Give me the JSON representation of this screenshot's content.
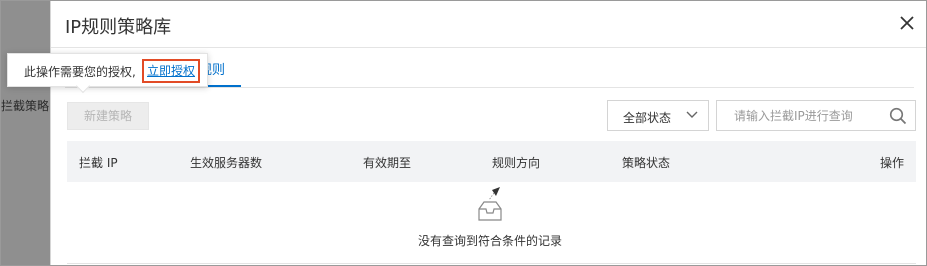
{
  "background": {
    "partial_text": "拦截策略"
  },
  "dialog": {
    "title": "IP规则策略库",
    "tab_active_label_visible": "规则"
  },
  "tooltip": {
    "text": "此操作需要您的授权,",
    "link_label": "立即授权"
  },
  "toolbar": {
    "new_button_label": "新建策略",
    "status_select_value": "全部状态",
    "search_placeholder": "请输入拦截IP进行查询"
  },
  "table": {
    "columns": [
      "拦截 IP",
      "生效服务器数",
      "有效期至",
      "规则方向",
      "策略状态",
      "操作"
    ],
    "empty_text": "没有查询到符合条件的记录"
  },
  "colors": {
    "link_blue": "#0070cc",
    "highlight_border": "#e24b26",
    "header_bg": "#f2f3f5"
  }
}
